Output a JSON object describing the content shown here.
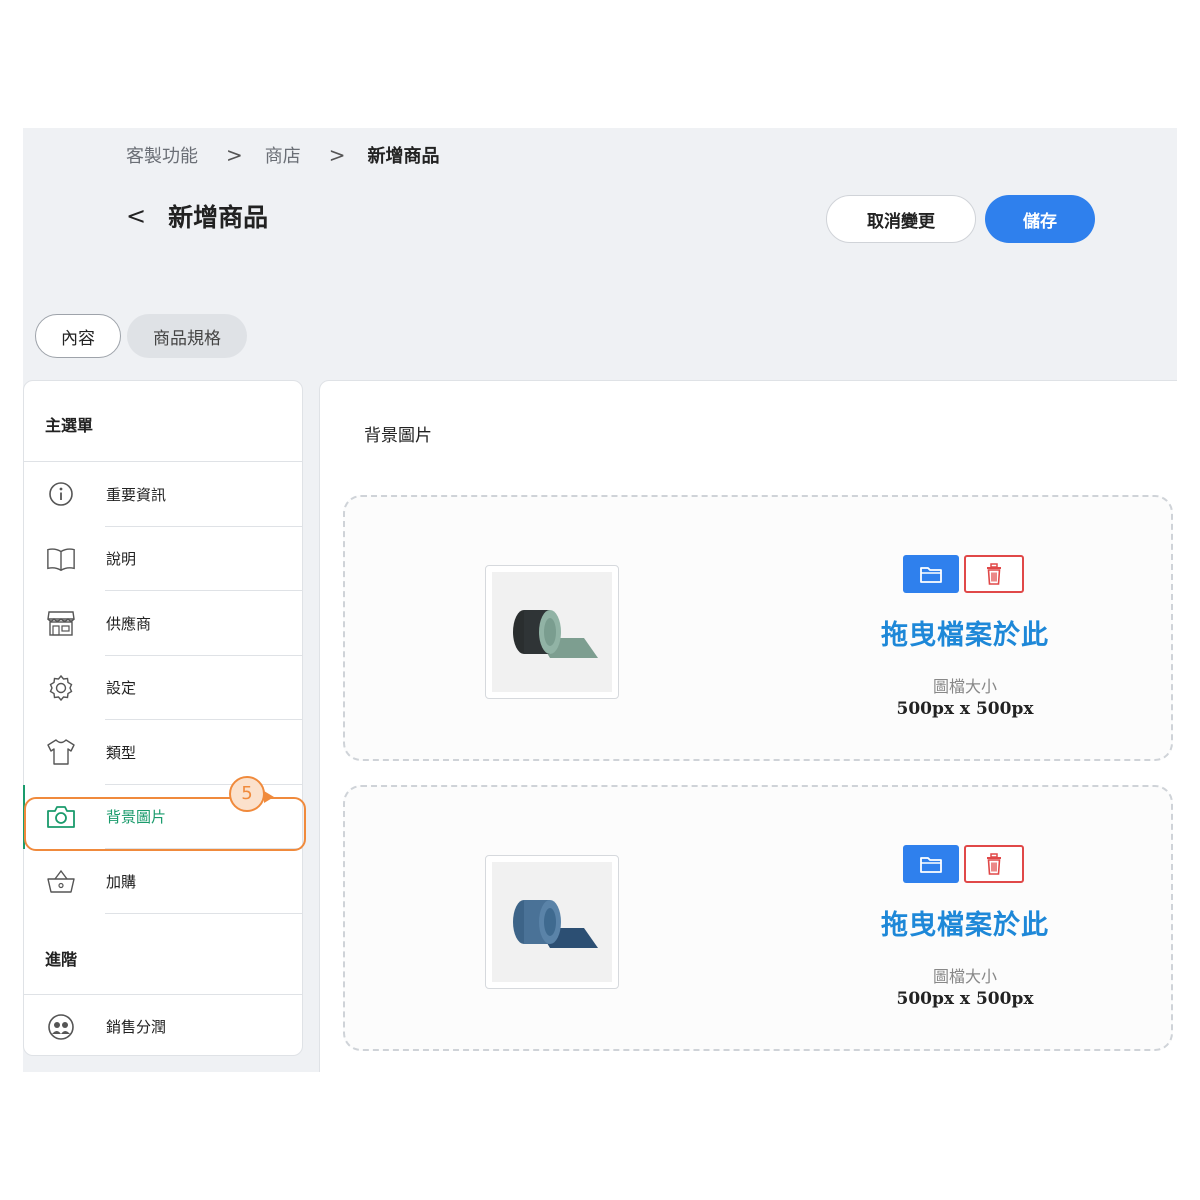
{
  "breadcrumb": {
    "items": [
      "客製功能",
      "商店",
      "新增商品"
    ],
    "separator": ">"
  },
  "header": {
    "back": "<",
    "title": "新增商品",
    "cancel_label": "取消變更",
    "save_label": "儲存"
  },
  "tabs": [
    {
      "label": "內容",
      "active": true
    },
    {
      "label": "商品規格",
      "active": false
    }
  ],
  "sidebar": {
    "main_section": "主選單",
    "items": [
      {
        "label": "重要資訊",
        "icon": "info-icon"
      },
      {
        "label": "說明",
        "icon": "book-icon"
      },
      {
        "label": "供應商",
        "icon": "store-icon"
      },
      {
        "label": "設定",
        "icon": "gear-icon"
      },
      {
        "label": "類型",
        "icon": "shirt-icon"
      },
      {
        "label": "背景圖片",
        "icon": "camera-icon",
        "active": true
      },
      {
        "label": "加購",
        "icon": "basket-icon"
      }
    ],
    "advanced_section": "進階",
    "advanced_items": [
      {
        "label": "銷售分潤",
        "icon": "profit-share-icon"
      }
    ],
    "step_badge": "5"
  },
  "panel": {
    "title": "背景圖片",
    "uploads": [
      {
        "drop_text": "拖曳檔案於此",
        "size_label": "圖檔大小",
        "size_value": "500px x 500px",
        "image": "green-black-yoga-mat"
      },
      {
        "drop_text": "拖曳檔案於此",
        "size_label": "圖檔大小",
        "size_value": "500px x 500px",
        "image": "blue-yoga-mat"
      }
    ]
  },
  "colors": {
    "primary": "#2f80ed",
    "active_menu": "#1a9b6c",
    "highlight": "#f08a3c",
    "delete": "#e04848",
    "drop_text": "#1e88d8"
  }
}
